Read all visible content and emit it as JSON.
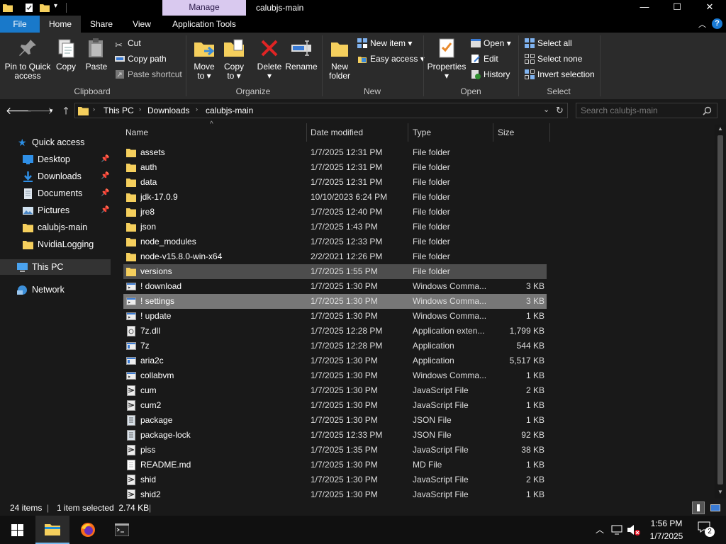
{
  "window": {
    "title": "calubjs-main",
    "manage_label": "Manage",
    "controls": {
      "minimize": "—",
      "maximize": "☐",
      "close": "✕"
    }
  },
  "ribbon_tabs": [
    {
      "label": "File"
    },
    {
      "label": "Home"
    },
    {
      "label": "Share"
    },
    {
      "label": "View"
    },
    {
      "label": "Application Tools"
    }
  ],
  "ribbon": {
    "clipboard": {
      "group_label": "Clipboard",
      "pin_label_1": "Pin to Quick",
      "pin_label_2": "access",
      "copy_label": "Copy",
      "paste_label": "Paste",
      "cut_label": "Cut",
      "copy_path_label": "Copy path",
      "paste_shortcut_label": "Paste shortcut"
    },
    "organize": {
      "group_label": "Organize",
      "move_label_1": "Move",
      "move_label_2": "to ▾",
      "copyto_label_1": "Copy",
      "copyto_label_2": "to ▾",
      "delete_label_1": "Delete",
      "delete_label_2": "▾",
      "rename_label": "Rename"
    },
    "new": {
      "group_label": "New",
      "new_folder_1": "New",
      "new_folder_2": "folder",
      "new_item_label": "New item ▾",
      "easy_access_label": "Easy access ▾"
    },
    "open": {
      "group_label": "Open",
      "properties_label": "Properties",
      "properties_caret": "▾",
      "open_label": "Open ▾",
      "edit_label": "Edit",
      "history_label": "History"
    },
    "select": {
      "group_label": "Select",
      "select_all_label": "Select all",
      "select_none_label": "Select none",
      "invert_label": "Invert selection"
    }
  },
  "address": {
    "crumbs": [
      "This PC",
      "Downloads",
      "calubjs-main"
    ],
    "search_placeholder": "Search calubjs-main"
  },
  "nav": {
    "quick_access": "Quick access",
    "items": [
      {
        "label": "Desktop",
        "pinned": true
      },
      {
        "label": "Downloads",
        "pinned": true
      },
      {
        "label": "Documents",
        "pinned": true
      },
      {
        "label": "Pictures",
        "pinned": true
      },
      {
        "label": "calubjs-main",
        "pinned": false
      },
      {
        "label": "NvidiaLogging",
        "pinned": false
      }
    ],
    "this_pc": "This PC",
    "network": "Network"
  },
  "columns": {
    "name": "Name",
    "date": "Date modified",
    "type": "Type",
    "size": "Size"
  },
  "files": [
    {
      "name": "assets",
      "date": "1/7/2025 12:31 PM",
      "type": "File folder",
      "size": "",
      "icon": "folder-icon"
    },
    {
      "name": "auth",
      "date": "1/7/2025 12:31 PM",
      "type": "File folder",
      "size": "",
      "icon": "folder-icon"
    },
    {
      "name": "data",
      "date": "1/7/2025 12:31 PM",
      "type": "File folder",
      "size": "",
      "icon": "folder-icon"
    },
    {
      "name": "jdk-17.0.9",
      "date": "10/10/2023 6:24 PM",
      "type": "File folder",
      "size": "",
      "icon": "folder-icon"
    },
    {
      "name": "jre8",
      "date": "1/7/2025 12:40 PM",
      "type": "File folder",
      "size": "",
      "icon": "folder-icon"
    },
    {
      "name": "json",
      "date": "1/7/2025 1:43 PM",
      "type": "File folder",
      "size": "",
      "icon": "folder-icon"
    },
    {
      "name": "node_modules",
      "date": "1/7/2025 12:33 PM",
      "type": "File folder",
      "size": "",
      "icon": "folder-icon"
    },
    {
      "name": "node-v15.8.0-win-x64",
      "date": "2/2/2021 12:26 PM",
      "type": "File folder",
      "size": "",
      "icon": "folder-icon"
    },
    {
      "name": "versions",
      "date": "1/7/2025 1:55 PM",
      "type": "File folder",
      "size": "",
      "icon": "folder-icon",
      "state": "hover"
    },
    {
      "name": "! download",
      "date": "1/7/2025 1:30 PM",
      "type": "Windows Comma...",
      "size": "3 KB",
      "icon": "cmd-file-icon"
    },
    {
      "name": "! settings",
      "date": "1/7/2025 1:30 PM",
      "type": "Windows Comma...",
      "size": "3 KB",
      "icon": "cmd-file-icon",
      "state": "selected"
    },
    {
      "name": "! update",
      "date": "1/7/2025 1:30 PM",
      "type": "Windows Comma...",
      "size": "1 KB",
      "icon": "cmd-file-icon"
    },
    {
      "name": "7z.dll",
      "date": "1/7/2025 12:28 PM",
      "type": "Application exten...",
      "size": "1,799 KB",
      "icon": "dll-file-icon"
    },
    {
      "name": "7z",
      "date": "1/7/2025 12:28 PM",
      "type": "Application",
      "size": "544 KB",
      "icon": "app-icon"
    },
    {
      "name": "aria2c",
      "date": "1/7/2025 1:30 PM",
      "type": "Application",
      "size": "5,517 KB",
      "icon": "app-icon"
    },
    {
      "name": "collabvm",
      "date": "1/7/2025 1:30 PM",
      "type": "Windows Comma...",
      "size": "1 KB",
      "icon": "cmd-file-icon"
    },
    {
      "name": "cum",
      "date": "1/7/2025 1:30 PM",
      "type": "JavaScript File",
      "size": "2 KB",
      "icon": "js-file-icon"
    },
    {
      "name": "cum2",
      "date": "1/7/2025 1:30 PM",
      "type": "JavaScript File",
      "size": "1 KB",
      "icon": "js-file-icon"
    },
    {
      "name": "package",
      "date": "1/7/2025 1:30 PM",
      "type": "JSON File",
      "size": "1 KB",
      "icon": "json-file-icon"
    },
    {
      "name": "package-lock",
      "date": "1/7/2025 12:33 PM",
      "type": "JSON File",
      "size": "92 KB",
      "icon": "json-file-icon"
    },
    {
      "name": "piss",
      "date": "1/7/2025 1:35 PM",
      "type": "JavaScript File",
      "size": "38 KB",
      "icon": "js-file-icon"
    },
    {
      "name": "README.md",
      "date": "1/7/2025 1:30 PM",
      "type": "MD File",
      "size": "1 KB",
      "icon": "text-file-icon"
    },
    {
      "name": "shid",
      "date": "1/7/2025 1:30 PM",
      "type": "JavaScript File",
      "size": "2 KB",
      "icon": "js-file-icon"
    },
    {
      "name": "shid2",
      "date": "1/7/2025 1:30 PM",
      "type": "JavaScript File",
      "size": "1 KB",
      "icon": "js-file-icon"
    }
  ],
  "status": {
    "item_count": "24 items",
    "separator": "|",
    "selection": "1 item selected  2.74 KB"
  },
  "taskbar": {
    "time": "1:56 PM",
    "date": "1/7/2025",
    "notification_count": "2"
  }
}
